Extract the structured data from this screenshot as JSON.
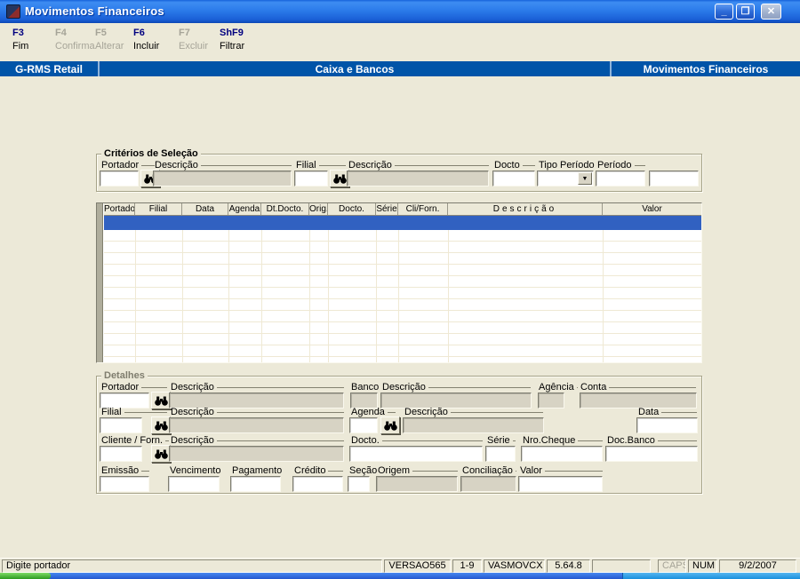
{
  "window": {
    "title": "Movimentos Financeiros"
  },
  "toolbar": {
    "items": [
      {
        "key": "F3",
        "label": "Fim",
        "enabled": true
      },
      {
        "key": "F4",
        "label": "Confirma",
        "enabled": false
      },
      {
        "key": "F5",
        "label": "Alterar",
        "enabled": false
      },
      {
        "key": "F6",
        "label": "Incluir",
        "enabled": true
      },
      {
        "key": "F7",
        "label": "Excluir",
        "enabled": false
      },
      {
        "key": "ShF9",
        "label": "Filtrar",
        "enabled": true
      }
    ]
  },
  "header": {
    "app": "G-RMS Retail",
    "module": "Caixa e Bancos",
    "screen": "Movimentos Financeiros",
    "color": "#0054A8"
  },
  "criteria": {
    "title": "Critérios de Seleção",
    "labels": {
      "portador": "Portador",
      "descricao_portador": "Descrição",
      "filial": "Filial",
      "descricao_filial": "Descrição",
      "docto": "Docto",
      "tipo_periodo": "Tipo Período",
      "periodo": "Período"
    }
  },
  "grid": {
    "columns": [
      "Portador",
      "Filial",
      "Data",
      "Agenda",
      "Dt.Docto.",
      "Orig.",
      "Docto.",
      "Série",
      "Cli/Forn.",
      "Descrição",
      "Valor"
    ],
    "selection_color": "#3161C1"
  },
  "details": {
    "title": "Detalhes",
    "labels": {
      "portador": "Portador",
      "descricao_portador": "Descrição",
      "banco": "Banco",
      "descricao_banco": "Descrição",
      "agencia": "Agência",
      "conta": "Conta",
      "filial": "Filial",
      "descricao_filial": "Descrição",
      "agenda": "Agenda",
      "descricao_agenda": "Descrição",
      "data": "Data",
      "cliente_forn": "Cliente / Forn.",
      "descricao_cliente": "Descrição",
      "docto": "Docto.",
      "serie": "Série",
      "nro_cheque": "Nro.Cheque",
      "doc_banco": "Doc.Banco",
      "emissao": "Emissão",
      "vencimento": "Vencimento",
      "pagamento": "Pagamento",
      "credito": "Crédito",
      "secao": "Seção",
      "origem": "Origem",
      "conciliacao": "Conciliação",
      "valor": "Valor"
    }
  },
  "statusbar": {
    "message": "Digite portador",
    "version": "VERSAO565",
    "record_range": "1-9",
    "program": "VASMOVCX",
    "build": "5.64.8",
    "caps": "CAPS",
    "num": "NUM",
    "date": "9/2/2007"
  }
}
